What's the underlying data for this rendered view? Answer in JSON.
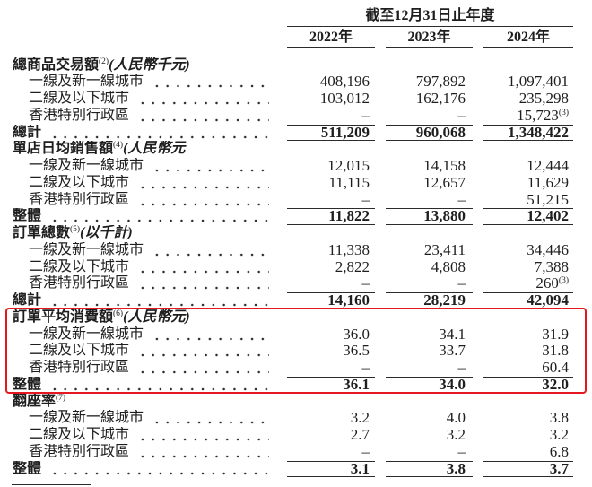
{
  "header": {
    "period": "截至12月31日止年度",
    "years": [
      "2022年",
      "2023年",
      "2024年"
    ]
  },
  "highlight": {
    "color": "#e3191f"
  },
  "sections": [
    {
      "title": "總商品交易額",
      "note": "(2)",
      "unit": "(人民幣千元)",
      "rows": [
        {
          "label": "一線及新一線城市",
          "values": [
            "408,196",
            "797,892",
            "1,097,401"
          ]
        },
        {
          "label": "二線及以下城市",
          "values": [
            "103,012",
            "162,176",
            "235,298"
          ]
        },
        {
          "label": "香港特別行政區",
          "values": [
            "–",
            "–",
            "15,723"
          ],
          "note": "(3)"
        }
      ],
      "total": {
        "label": "總計",
        "values": [
          "511,209",
          "960,068",
          "1,348,422"
        ]
      }
    },
    {
      "title": "單店日均銷售額",
      "note": "(4)",
      "unit": "(人民幣元",
      "rows": [
        {
          "label": "一線及新一線城市",
          "values": [
            "12,015",
            "14,158",
            "12,444"
          ]
        },
        {
          "label": "二線及以下城市",
          "values": [
            "11,115",
            "12,657",
            "11,629"
          ]
        },
        {
          "label": "香港特別行政區",
          "values": [
            "–",
            "–",
            "51,215"
          ]
        }
      ],
      "total": {
        "label": "整體",
        "values": [
          "11,822",
          "13,880",
          "12,402"
        ]
      }
    },
    {
      "title": "訂單總數",
      "note": "(5)",
      "unit": "(以千計)",
      "rows": [
        {
          "label": "一線及新一線城市",
          "values": [
            "11,338",
            "23,411",
            "34,446"
          ]
        },
        {
          "label": "二線及以下城市",
          "values": [
            "2,822",
            "4,808",
            "7,388"
          ]
        },
        {
          "label": "香港特別行政區",
          "values": [
            "–",
            "–",
            "260"
          ],
          "note": "(3)"
        }
      ],
      "total": {
        "label": "總計",
        "values": [
          "14,160",
          "28,219",
          "42,094"
        ]
      }
    },
    {
      "title": "訂單平均消費額",
      "note": "(6)",
      "unit": "(人民幣元)",
      "highlighted": true,
      "rows": [
        {
          "label": "一線及新一線城市",
          "values": [
            "36.0",
            "34.1",
            "31.9"
          ]
        },
        {
          "label": "二線及以下城市",
          "values": [
            "36.5",
            "33.7",
            "31.8"
          ]
        },
        {
          "label": "香港特別行政區",
          "values": [
            "–",
            "–",
            "60.4"
          ]
        }
      ],
      "total": {
        "label": "整體",
        "values": [
          "36.1",
          "34.0",
          "32.0"
        ]
      }
    },
    {
      "title": "翻座率",
      "note": "(7)",
      "rows": [
        {
          "label": "一線及新一線城市",
          "values": [
            "3.2",
            "4.0",
            "3.8"
          ]
        },
        {
          "label": "二線及以下城市",
          "values": [
            "2.7",
            "3.2",
            "3.2"
          ]
        },
        {
          "label": "香港特別行政區",
          "values": [
            "–",
            "–",
            "6.8"
          ]
        }
      ],
      "total": {
        "label": "整體",
        "values": [
          "3.1",
          "3.8",
          "3.7"
        ]
      }
    }
  ]
}
